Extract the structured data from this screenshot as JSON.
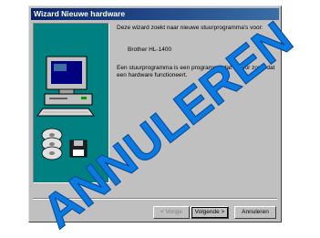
{
  "window": {
    "title": "Wizard Nieuwe hardware"
  },
  "content": {
    "intro": "Deze wizard zoekt naar nieuwe stuurprogramma's voor:",
    "device": "Brother HL-1400",
    "body": "Een stuurprogramma is een programma dat ervoor zorgt dat een hardware functioneert."
  },
  "buttons": {
    "back": "< Vorige",
    "next": "Volgende >",
    "cancel": "Annuleren"
  },
  "stamp": {
    "text": "ANNULEREN",
    "color": "#0a79e0"
  },
  "colors": {
    "titlebar": "#0a246a",
    "dialog": "#c0c0c0",
    "art_background": "#008080"
  },
  "icons": [
    "computer-icon",
    "cd-disc-icon",
    "floppy-disk-icon"
  ]
}
